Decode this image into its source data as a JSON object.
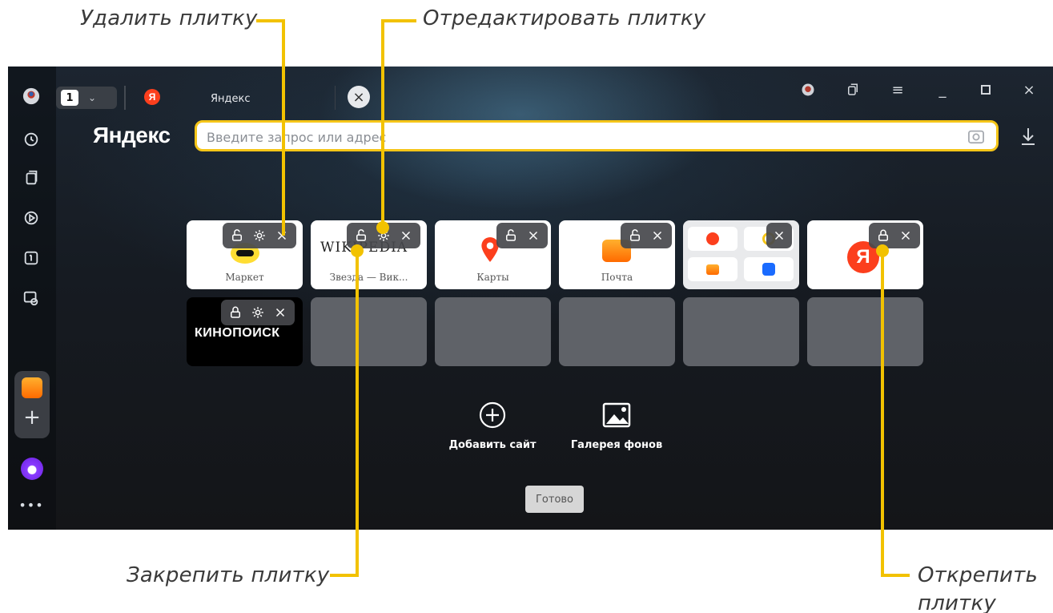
{
  "callouts": {
    "delete": "Удалить плитку",
    "edit": "Отредактировать плитку",
    "pin": "Закрепить плитку",
    "unpin_line1": "Открепить",
    "unpin_line2": "плитку"
  },
  "browser": {
    "tab_count": "1",
    "tab_title": "Яндекс",
    "logo": "Яндекс",
    "search_placeholder": "Введите запрос или адрес",
    "tiles": [
      {
        "label": "Маркет",
        "logo": "market"
      },
      {
        "label": "Звезда — Вик...",
        "logo_text": "WIKIPEDIA"
      },
      {
        "label": "Карты",
        "logo": "maps"
      },
      {
        "label": "Почта",
        "logo": "mail"
      },
      {
        "label": "",
        "logo": "group"
      },
      {
        "label": "",
        "logo_text": "Я"
      },
      {
        "label": "",
        "logo_text": "КИНОПОИСК"
      }
    ],
    "add_site": "Добавить сайт",
    "gallery": "Галерея фонов",
    "done": "Готово"
  },
  "colors": {
    "accent": "#f2c200",
    "search_border": "#f5c518",
    "yandex_red": "#fc3f1d"
  }
}
